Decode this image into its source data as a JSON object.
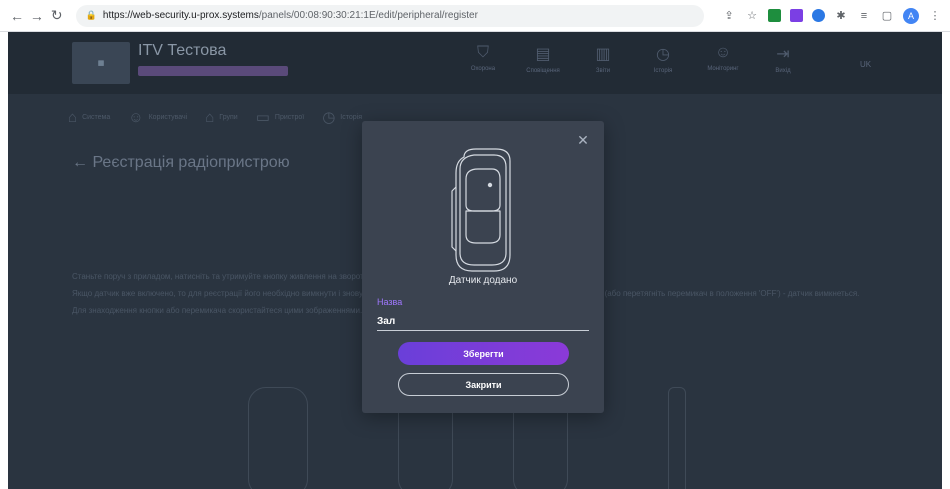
{
  "browser": {
    "url_host": "https://web-security.u-prox.systems",
    "url_path": "/panels/00:08:90:30:21:1E/edit/peripheral/register",
    "avatar_letter": "A",
    "extension_colors": [
      "#1e8e3e",
      "#7b3fe4",
      "#2b78e4"
    ]
  },
  "app": {
    "object_title": "ITV Тестова",
    "page_title": "← Реєстрація радіопристрою",
    "subnav": [
      {
        "icon": "home-icon",
        "glyph": "⌂",
        "label": "Система"
      },
      {
        "icon": "users-icon",
        "glyph": "☺",
        "label": "Користувачі"
      },
      {
        "icon": "groups-icon",
        "glyph": "⌂",
        "label": "Групи"
      },
      {
        "icon": "devices-icon",
        "glyph": "▭",
        "label": "Пристрої"
      },
      {
        "icon": "history-icon",
        "glyph": "◷",
        "label": "Історія"
      }
    ],
    "top_items": [
      {
        "icon": "shield-icon",
        "glyph": "⛉",
        "label": "Охорона"
      },
      {
        "icon": "events-icon",
        "glyph": "▤",
        "label": "Сповіщення"
      },
      {
        "icon": "doc-icon",
        "glyph": "▥",
        "label": "Звіти"
      },
      {
        "icon": "clock-icon",
        "glyph": "◷",
        "label": "Історія"
      },
      {
        "icon": "monitor-icon",
        "glyph": "☺",
        "label": "Моніторинг"
      },
      {
        "icon": "exit-icon",
        "glyph": "⇥",
        "label": "Вихід"
      }
    ],
    "lang": "UK",
    "instructions": [
      "Станьте поруч з приладом, натисніть та утримуйте кнопку живлення на зворотному боці пристрою, і дочекайтеся його активації.",
      "Якщо датчик вже включено, то для реєстрації його необхідно вимкнути і знову ввімкнути, для чого натисніть на кнопку і потримайте її 5 секунд (або перетягніть перемикач в положення 'OFF') - датчик вимкнеться.",
      "Для знаходження кнопки або перемикача скористайтеся цими зображеннями."
    ]
  },
  "modal": {
    "message": "Датчик додано",
    "name_label": "Назва",
    "name_value": "Зал",
    "save_label": "Зберегти",
    "close_label": "Закрити",
    "accent_color": "#7b3fe4"
  }
}
